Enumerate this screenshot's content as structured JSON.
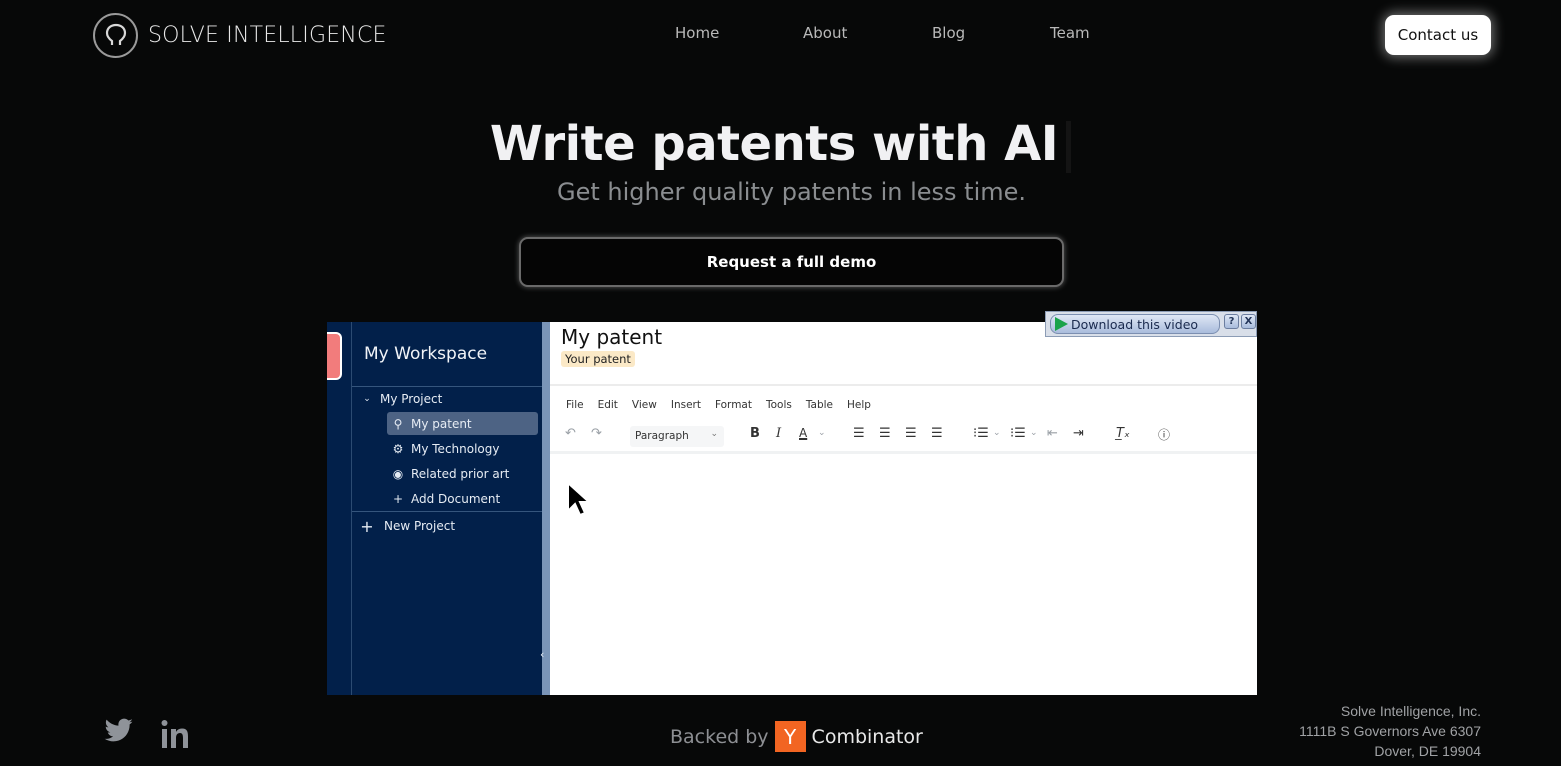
{
  "header": {
    "brand": "SOLVE INTELLIGENCE",
    "nav": [
      {
        "label": "Home"
      },
      {
        "label": "About"
      },
      {
        "label": "Blog"
      },
      {
        "label": "Team"
      }
    ],
    "contact_label": "Contact us"
  },
  "hero": {
    "title": "Write patents with AI",
    "subtitle": "Get higher quality patents in less time.",
    "cta_label": "Request a full demo"
  },
  "app": {
    "workspace_title": "My Workspace",
    "project": "My Project",
    "documents": [
      {
        "label": "My patent",
        "icon": "lightbulb-icon",
        "selected": true
      },
      {
        "label": "My Technology",
        "icon": "gear-icon",
        "selected": false
      },
      {
        "label": "Related prior art",
        "icon": "target-icon",
        "selected": false
      },
      {
        "label": "Add Document",
        "icon": "plus-icon",
        "selected": false
      }
    ],
    "new_project": "New Project",
    "doc_title": "My patent",
    "doc_tag": "Your patent",
    "menu": [
      "File",
      "Edit",
      "View",
      "Insert",
      "Format",
      "Tools",
      "Table",
      "Help"
    ],
    "block_format": "Paragraph"
  },
  "overlay": {
    "download_label": "Download this video",
    "help_label": "?",
    "close_label": "X"
  },
  "footer": {
    "backed_by": "Backed by",
    "yc_letter": "Y",
    "combinator": "Combinator",
    "address": [
      "Solve Intelligence, Inc.",
      "1111B S Governors Ave 6307",
      "Dover, DE 19904"
    ],
    "social": [
      "twitter-icon",
      "linkedin-icon"
    ]
  }
}
